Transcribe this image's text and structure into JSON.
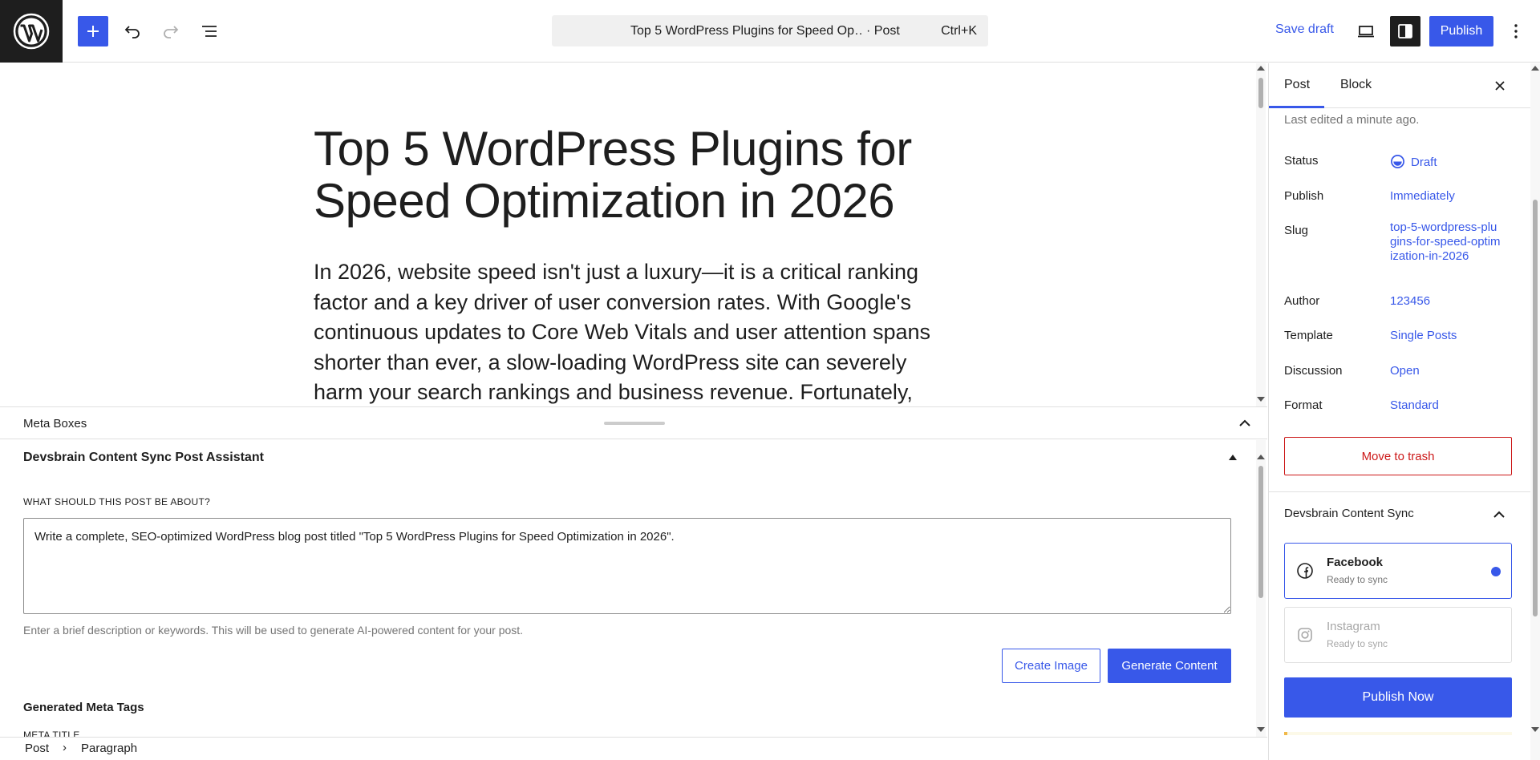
{
  "topbar": {
    "document_title": "Top 5 WordPress Plugins for Speed Op…",
    "document_type": "· Post",
    "shortcut": "Ctrl+K",
    "save_draft": "Save draft",
    "publish": "Publish"
  },
  "editor": {
    "title": "Top 5 WordPress Plugins for Speed Optimization in 2026",
    "paragraph": "In 2026, website speed isn't just a luxury—it is a critical ranking factor and a key driver of user conversion rates. With Google's continuous updates to Core Web Vitals and user attention spans shorter than ever, a slow-loading WordPress site can severely harm your search rankings and business revenue. Fortunately, you"
  },
  "meta_boxes": {
    "header": "Meta Boxes",
    "box_title": "Devsbrain Content Sync Post Assistant",
    "prompt_label": "WHAT SHOULD THIS POST BE ABOUT?",
    "prompt_value": "Write a complete, SEO-optimized WordPress blog post titled \"Top 5 WordPress Plugins for Speed Optimization in 2026\".",
    "prompt_help": "Enter a brief description or keywords. This will be used to generate AI-powered content for your post.",
    "create_image": "Create Image",
    "generate_content": "Generate Content",
    "generated_heading": "Generated Meta Tags",
    "meta_title_label": "META TITLE"
  },
  "breadcrumb": {
    "root": "Post",
    "separator": "›",
    "current": "Paragraph"
  },
  "sidebar": {
    "tab_post": "Post",
    "tab_block": "Block",
    "last_edited": "Last edited a minute ago.",
    "rows": [
      {
        "label": "Status",
        "value": "Draft"
      },
      {
        "label": "Publish",
        "value": "Immediately"
      },
      {
        "label": "Slug",
        "value": "top-5-wordpress-plugins-for-speed-optimization-in-2026"
      },
      {
        "label": "Author",
        "value": "123456"
      },
      {
        "label": "Template",
        "value": "Single Posts"
      },
      {
        "label": "Discussion",
        "value": "Open"
      },
      {
        "label": "Format",
        "value": "Standard"
      }
    ],
    "trash": "Move to trash",
    "panel_title": "Devsbrain Content Sync",
    "platforms": [
      {
        "name": "Facebook",
        "status": "Ready to sync"
      },
      {
        "name": "Instagram",
        "status": "Ready to sync"
      }
    ],
    "publish_now": "Publish Now"
  },
  "colors": {
    "accent": "#3858e9",
    "destructive": "#cc1818",
    "dark": "#1e1e1e"
  }
}
